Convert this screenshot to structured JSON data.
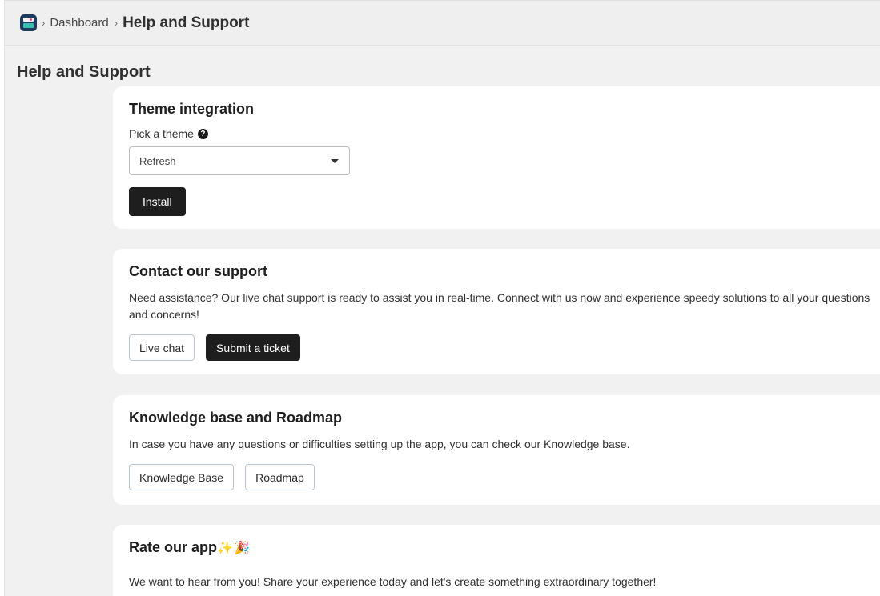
{
  "breadcrumb": {
    "separator": "›",
    "items": [
      "Dashboard",
      "Help and Support"
    ]
  },
  "page": {
    "title": "Help and Support"
  },
  "theme_card": {
    "title": "Theme integration",
    "field_label": "Pick a theme",
    "help_icon": "question-icon",
    "select_value": "Refresh",
    "install_label": "Install"
  },
  "contact_card": {
    "title": "Contact our support",
    "body": "Need assistance? Our live chat support is ready to assist you in real-time. Connect with us now and experience speedy solutions to all your questions and concerns!",
    "live_chat_label": "Live chat",
    "ticket_label": "Submit a ticket"
  },
  "kb_card": {
    "title": "Knowledge base and Roadmap",
    "body": "In case you have any questions or difficulties setting up the app, you can check our Knowledge base.",
    "kb_label": "Knowledge Base",
    "roadmap_label": "Roadmap"
  },
  "rate_card": {
    "title": "Rate our app",
    "emoji": "✨🎉",
    "body": "We want to hear from you! Share your experience today and let's create something extraordinary together!"
  },
  "colors": {
    "background": "#f1f1f1",
    "card": "#ffffff",
    "primary_button": "#1e1e1e"
  }
}
